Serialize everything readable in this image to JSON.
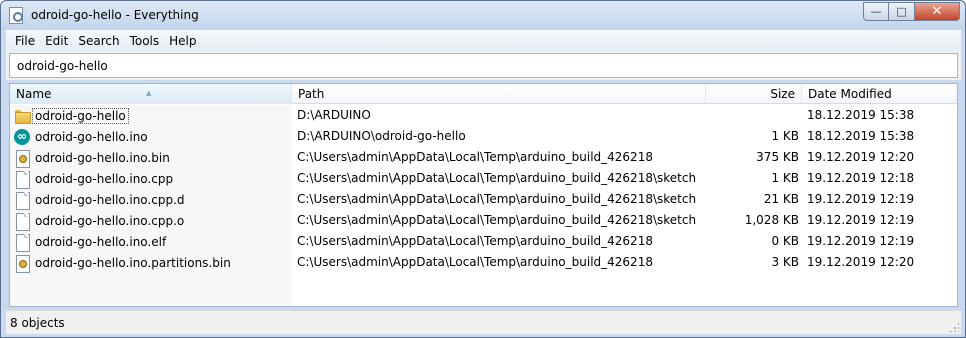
{
  "window": {
    "title": "odroid-go-hello - Everything",
    "buttons": {
      "minimize": "—",
      "maximize": "□",
      "close": "✕"
    }
  },
  "menu": [
    "File",
    "Edit",
    "Search",
    "Tools",
    "Help"
  ],
  "search": {
    "value": "odroid-go-hello"
  },
  "columns": {
    "name": "Name",
    "path": "Path",
    "size": "Size",
    "date": "Date Modified"
  },
  "rows": [
    {
      "icon": "folder-icon",
      "name": "odroid-go-hello",
      "path": "D:\\ARDUINO",
      "size": "",
      "date": "18.12.2019 15:38"
    },
    {
      "icon": "arduino-icon",
      "name": "odroid-go-hello.ino",
      "path": "D:\\ARDUINO\\odroid-go-hello",
      "size": "1 KB",
      "date": "18.12.2019 15:38"
    },
    {
      "icon": "binary-file-icon",
      "name": "odroid-go-hello.ino.bin",
      "path": "C:\\Users\\admin\\AppData\\Local\\Temp\\arduino_build_426218",
      "size": "375 KB",
      "date": "19.12.2019 12:20"
    },
    {
      "icon": "file-icon",
      "name": "odroid-go-hello.ino.cpp",
      "path": "C:\\Users\\admin\\AppData\\Local\\Temp\\arduino_build_426218\\sketch",
      "size": "1 KB",
      "date": "19.12.2019 12:18"
    },
    {
      "icon": "file-icon",
      "name": "odroid-go-hello.ino.cpp.d",
      "path": "C:\\Users\\admin\\AppData\\Local\\Temp\\arduino_build_426218\\sketch",
      "size": "21 KB",
      "date": "19.12.2019 12:19"
    },
    {
      "icon": "file-icon",
      "name": "odroid-go-hello.ino.cpp.o",
      "path": "C:\\Users\\admin\\AppData\\Local\\Temp\\arduino_build_426218\\sketch",
      "size": "1,028 KB",
      "date": "19.12.2019 12:19"
    },
    {
      "icon": "file-icon",
      "name": "odroid-go-hello.ino.elf",
      "path": "C:\\Users\\admin\\AppData\\Local\\Temp\\arduino_build_426218",
      "size": "0 KB",
      "date": "19.12.2019 12:19"
    },
    {
      "icon": "binary-file-icon",
      "name": "odroid-go-hello.ino.partitions.bin",
      "path": "C:\\Users\\admin\\AppData\\Local\\Temp\\arduino_build_426218",
      "size": "3 KB",
      "date": "19.12.2019 12:20"
    }
  ],
  "status": {
    "text": "8 objects"
  }
}
